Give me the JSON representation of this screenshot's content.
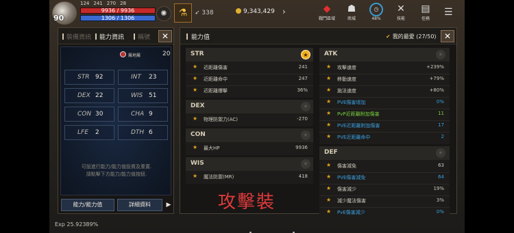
{
  "hud": {
    "level": "90",
    "mini_stats": [
      "124",
      "241",
      "270",
      "28"
    ],
    "hp_text": "9936 / 9936",
    "mp_text": "1306 / 1306",
    "hp_fraction": 1.0,
    "mp_fraction": 1.0,
    "wing_value": "338",
    "gold": "9,343,429",
    "icons": [
      {
        "name": "ranking-emblem",
        "label": "戰鬥區域",
        "glyph": "◆"
      },
      {
        "name": "shop-icon",
        "label": "商城",
        "glyph": "☗"
      },
      {
        "name": "auto-icon",
        "label": "48%",
        "glyph": "◷"
      },
      {
        "name": "skill-icon",
        "label": "技能",
        "glyph": "✕"
      },
      {
        "name": "quest-icon",
        "label": "任務",
        "glyph": "▤"
      }
    ],
    "potion_glyph": "⚗"
  },
  "left_panel": {
    "tabs": [
      "裝備資訊",
      "能力資訊",
      "稱號"
    ],
    "active_tab": 1,
    "element_label": "屬地屬",
    "element_value": "20",
    "stats": [
      {
        "name": "STR",
        "value": "92"
      },
      {
        "name": "INT",
        "value": "23"
      },
      {
        "name": "DEX",
        "value": "22"
      },
      {
        "name": "WIS",
        "value": "51"
      },
      {
        "name": "CON",
        "value": "30"
      },
      {
        "name": "CHA",
        "value": "9"
      },
      {
        "name": "LFE",
        "value": "2"
      },
      {
        "name": "DTH",
        "value": "6"
      }
    ],
    "note_line1": "可設進行能力/能力值投資及重置.",
    "note_line2": "請點擊下方能力/能力值按鈕.",
    "btn_ability": "能力/能力值",
    "btn_detail": "詳細資料",
    "arrow": "▶"
  },
  "right_panel": {
    "title": "能力值",
    "favorites_label": "我的最愛 (27/50)",
    "sections_left": [
      {
        "title": "STR",
        "starred": true,
        "rows": [
          {
            "label": "近距離傷害",
            "value": "241",
            "type": "normal",
            "star": true
          },
          {
            "label": "近距離命中",
            "value": "247",
            "type": "normal",
            "star": true
          },
          {
            "label": "近距離爆擊",
            "value": "36%",
            "type": "normal",
            "star": true
          }
        ]
      },
      {
        "title": "DEX",
        "starred": false,
        "rows": [
          {
            "label": "物理防禦力(AC)",
            "value": "-270",
            "type": "normal",
            "star": true
          }
        ]
      },
      {
        "title": "CON",
        "starred": false,
        "rows": [
          {
            "label": "最大HP",
            "value": "9936",
            "type": "normal",
            "star": true
          }
        ]
      },
      {
        "title": "WIS",
        "starred": false,
        "rows": [
          {
            "label": "魔法防禦(MR)",
            "value": "418",
            "type": "normal",
            "star": true
          }
        ]
      }
    ],
    "sections_right": [
      {
        "title": "ATK",
        "starred": false,
        "rows": [
          {
            "label": "攻擊速度",
            "value": "+239%",
            "type": "normal",
            "star": true
          },
          {
            "label": "移動速度",
            "value": "+79%",
            "type": "normal",
            "star": true
          },
          {
            "label": "施法速度",
            "value": "+80%",
            "type": "normal",
            "star": true
          },
          {
            "label": "PVE傷害增加",
            "value": "0%",
            "type": "pve",
            "star": true
          },
          {
            "label": "PvP近距離附加傷害",
            "value": "11",
            "type": "pvp",
            "star": true
          },
          {
            "label": "PVE近距離附加傷害",
            "value": "17",
            "type": "pve",
            "star": true
          },
          {
            "label": "PVE近距離命中",
            "value": "2",
            "type": "pve",
            "star": true
          }
        ]
      },
      {
        "title": "DEF",
        "starred": false,
        "rows": [
          {
            "label": "傷害減免",
            "value": "63",
            "type": "normal",
            "star": true
          },
          {
            "label": "PVE傷害減免",
            "value": "64",
            "type": "pve",
            "star": true
          },
          {
            "label": "傷害減少",
            "value": "19%",
            "type": "normal",
            "star": true
          },
          {
            "label": "減少魔法傷害",
            "value": "3%",
            "type": "normal",
            "star": true
          },
          {
            "label": "PvE傷害減少",
            "value": "0%",
            "type": "pve",
            "star": true
          }
        ]
      }
    ]
  },
  "caption": "攻擊裝",
  "exp_text": "Exp 25.92389%",
  "colors": {
    "accent_star": "#f0b020",
    "pve": "#3aa0e0",
    "pvp": "#7ad040",
    "caption": "#e03a3a",
    "hp": "#c42a2a",
    "mp": "#3a6ad0"
  }
}
